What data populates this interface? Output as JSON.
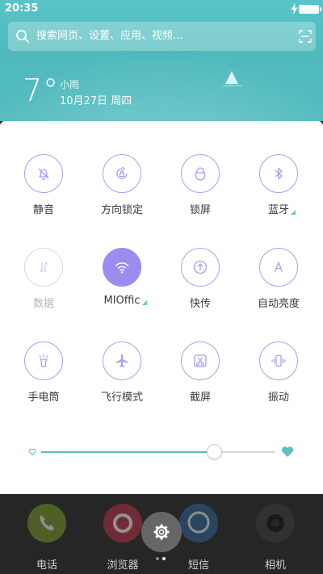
{
  "status": {
    "time": "20:35"
  },
  "search": {
    "placeholder": "搜索网页、设置、应用、视频..."
  },
  "weather": {
    "temperature": "7°",
    "condition": "小雨",
    "date": "10月27日 周四"
  },
  "tiles": [
    {
      "label": "静音",
      "icon": "bell-off-icon",
      "state": "off"
    },
    {
      "label": "方向锁定",
      "icon": "rotation-lock-icon",
      "state": "off"
    },
    {
      "label": "锁屏",
      "icon": "lock-icon",
      "state": "off"
    },
    {
      "label": "蓝牙",
      "icon": "bluetooth-icon",
      "state": "off",
      "expandable": true
    },
    {
      "label": "数据",
      "icon": "mobile-data-icon",
      "state": "disabled"
    },
    {
      "label": "MIOffic",
      "icon": "wifi-icon",
      "state": "on",
      "expandable": true
    },
    {
      "label": "快传",
      "icon": "share-transfer-icon",
      "state": "off"
    },
    {
      "label": "自动亮度",
      "icon": "auto-brightness-icon",
      "state": "off"
    },
    {
      "label": "手电筒",
      "icon": "flashlight-icon",
      "state": "off"
    },
    {
      "label": "飞行模式",
      "icon": "airplane-icon",
      "state": "off"
    },
    {
      "label": "截屏",
      "icon": "screenshot-icon",
      "state": "off"
    },
    {
      "label": "振动",
      "icon": "vibrate-icon",
      "state": "off"
    }
  ],
  "brightness": {
    "level": 0.74
  },
  "dock": {
    "apps": [
      {
        "label": "电话",
        "icon": "phone-icon"
      },
      {
        "label": "浏览器",
        "icon": "browser-icon"
      },
      {
        "label": "短信",
        "icon": "messages-icon"
      },
      {
        "label": "相机",
        "icon": "camera-icon"
      }
    ],
    "settings_icon": "gear-icon",
    "page_count": 2,
    "current_page": 2
  },
  "colors": {
    "accent": "#9b8cf0",
    "outline": "#a99ff0",
    "teal": "#5dbdc1",
    "header": "#54bcc0"
  }
}
